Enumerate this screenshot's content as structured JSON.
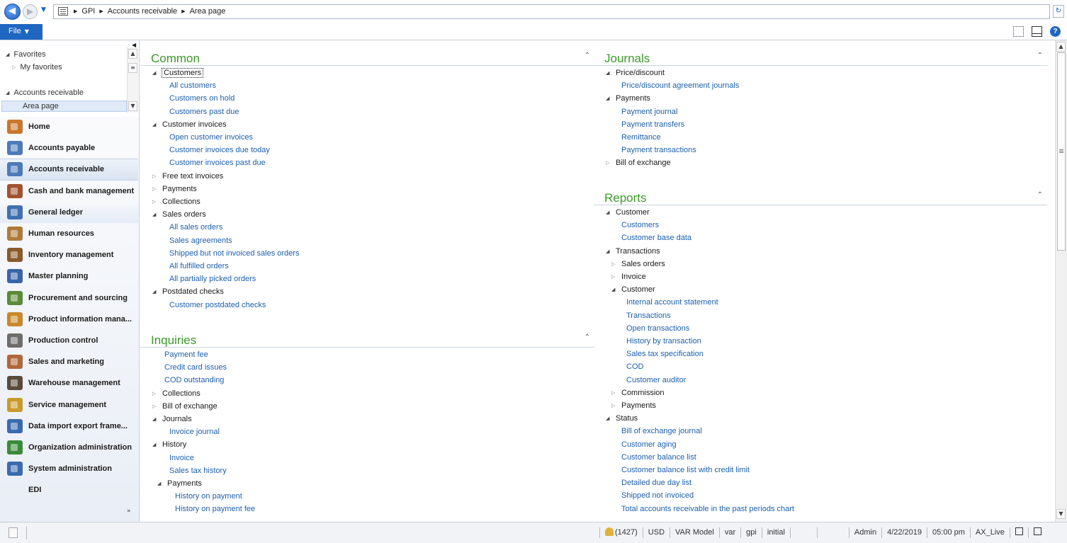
{
  "address_bar": {
    "breadcrumb": [
      "GPI",
      "Accounts receivable",
      "Area page"
    ]
  },
  "filebar": {
    "file_label": "File"
  },
  "favorites": {
    "favorites_label": "Favorites",
    "my_favorites_label": "My favorites",
    "area_label": "Accounts receivable",
    "area_page_label": "Area page"
  },
  "modules": [
    {
      "label": "Home",
      "color": "#c9772c"
    },
    {
      "label": "Accounts payable",
      "color": "#4d7ab8"
    },
    {
      "label": "Accounts receivable",
      "color": "#4d7ab8"
    },
    {
      "label": "Cash and bank management",
      "color": "#a0522d"
    },
    {
      "label": "General ledger",
      "color": "#3f6fb0"
    },
    {
      "label": "Human resources",
      "color": "#b07a3a"
    },
    {
      "label": "Inventory management",
      "color": "#8a5a2a"
    },
    {
      "label": "Master planning",
      "color": "#3a66a8"
    },
    {
      "label": "Procurement and sourcing",
      "color": "#5b8a3a"
    },
    {
      "label": "Product information mana...",
      "color": "#c8892c"
    },
    {
      "label": "Production control",
      "color": "#6d6d6d"
    },
    {
      "label": "Sales and marketing",
      "color": "#b0663a"
    },
    {
      "label": "Warehouse management",
      "color": "#5a4a3a"
    },
    {
      "label": "Service management",
      "color": "#c99a2c"
    },
    {
      "label": "Data import export frame...",
      "color": "#3a6ab0"
    },
    {
      "label": "Organization administration",
      "color": "#3a8a3a"
    },
    {
      "label": "System administration",
      "color": "#3a6ab0"
    },
    {
      "label": "EDI",
      "color": ""
    }
  ],
  "common": {
    "title": "Common",
    "items": [
      {
        "label": "Customers",
        "kind": "group",
        "open": true
      },
      {
        "label": "All customers",
        "kind": "link"
      },
      {
        "label": "Customers on hold",
        "kind": "link"
      },
      {
        "label": "Customers past due",
        "kind": "link"
      },
      {
        "label": "Customer invoices",
        "kind": "group",
        "open": true
      },
      {
        "label": "Open customer invoices",
        "kind": "link"
      },
      {
        "label": "Customer invoices due today",
        "kind": "link"
      },
      {
        "label": "Customer invoices past due",
        "kind": "link"
      },
      {
        "label": "Free text invoices",
        "kind": "group",
        "open": false
      },
      {
        "label": "Payments",
        "kind": "group",
        "open": false
      },
      {
        "label": "Collections",
        "kind": "group",
        "open": false
      },
      {
        "label": "Sales orders",
        "kind": "group",
        "open": true
      },
      {
        "label": "All sales orders",
        "kind": "link"
      },
      {
        "label": "Sales agreements",
        "kind": "link"
      },
      {
        "label": "Shipped but not invoiced sales orders",
        "kind": "link"
      },
      {
        "label": "All fulfilled orders",
        "kind": "link"
      },
      {
        "label": "All partially picked orders",
        "kind": "link"
      },
      {
        "label": "Postdated checks",
        "kind": "group",
        "open": true
      },
      {
        "label": "Customer postdated checks",
        "kind": "link"
      }
    ]
  },
  "inquiries": {
    "title": "Inquiries",
    "items": [
      {
        "label": "Payment fee",
        "kind": "link"
      },
      {
        "label": "Credit card issues",
        "kind": "link"
      },
      {
        "label": "COD outstanding",
        "kind": "link"
      },
      {
        "label": "Collections",
        "kind": "group",
        "open": false
      },
      {
        "label": "Bill of exchange",
        "kind": "group",
        "open": false
      },
      {
        "label": "Journals",
        "kind": "group",
        "open": true
      },
      {
        "label": "Invoice journal",
        "kind": "link"
      },
      {
        "label": "History",
        "kind": "group",
        "open": true
      },
      {
        "label": "Invoice",
        "kind": "link"
      },
      {
        "label": "Sales tax history",
        "kind": "link"
      },
      {
        "label": "Payments",
        "kind": "group",
        "open": true
      },
      {
        "label": "History on payment",
        "kind": "link"
      },
      {
        "label": "History on payment fee",
        "kind": "link"
      }
    ]
  },
  "journals": {
    "title": "Journals",
    "items": [
      {
        "label": "Price/discount",
        "kind": "group",
        "open": true
      },
      {
        "label": "Price/discount agreement journals",
        "kind": "link"
      },
      {
        "label": "Payments",
        "kind": "group",
        "open": true
      },
      {
        "label": "Payment journal",
        "kind": "link"
      },
      {
        "label": "Payment transfers",
        "kind": "link"
      },
      {
        "label": "Remittance",
        "kind": "link"
      },
      {
        "label": "Payment transactions",
        "kind": "link"
      },
      {
        "label": "Bill of exchange",
        "kind": "group",
        "open": false
      }
    ]
  },
  "reports": {
    "title": "Reports",
    "items": [
      {
        "label": "Customer",
        "kind": "group",
        "open": true
      },
      {
        "label": "Customers",
        "kind": "link"
      },
      {
        "label": "Customer base data",
        "kind": "link"
      },
      {
        "label": "Transactions",
        "kind": "group",
        "open": true
      },
      {
        "label": "Sales orders",
        "kind": "group",
        "open": false
      },
      {
        "label": "Invoice",
        "kind": "group",
        "open": false
      },
      {
        "label": "Customer",
        "kind": "group",
        "open": true
      },
      {
        "label": "Internal account statement",
        "kind": "link"
      },
      {
        "label": "Transactions",
        "kind": "link"
      },
      {
        "label": "Open transactions",
        "kind": "link"
      },
      {
        "label": "History by transaction",
        "kind": "link"
      },
      {
        "label": "Sales tax specification",
        "kind": "link"
      },
      {
        "label": "COD",
        "kind": "link"
      },
      {
        "label": "Customer auditor",
        "kind": "link"
      },
      {
        "label": "Commission",
        "kind": "group",
        "open": false
      },
      {
        "label": "Payments",
        "kind": "group",
        "open": false
      },
      {
        "label": "Status",
        "kind": "group",
        "open": true
      },
      {
        "label": "Bill of exchange journal",
        "kind": "link"
      },
      {
        "label": "Customer aging",
        "kind": "link"
      },
      {
        "label": "Customer balance list",
        "kind": "link"
      },
      {
        "label": "Customer balance list with credit limit",
        "kind": "link"
      },
      {
        "label": "Detailed due day list",
        "kind": "link"
      },
      {
        "label": "Shipped not invoiced",
        "kind": "link"
      },
      {
        "label": "Total accounts receivable in the past periods chart",
        "kind": "link"
      }
    ]
  },
  "statusbar": {
    "notifications": "(1427)",
    "currency": "USD",
    "model": "VAR Model",
    "layer": "var",
    "company": "gpi",
    "status": "initial",
    "user": "Admin",
    "date": "4/22/2019",
    "time": "05:00 pm",
    "instance": "AX_Live"
  },
  "colors": {
    "accent": "#1f66c1",
    "section_title": "#3a9a27",
    "link": "#1c5fb0"
  }
}
